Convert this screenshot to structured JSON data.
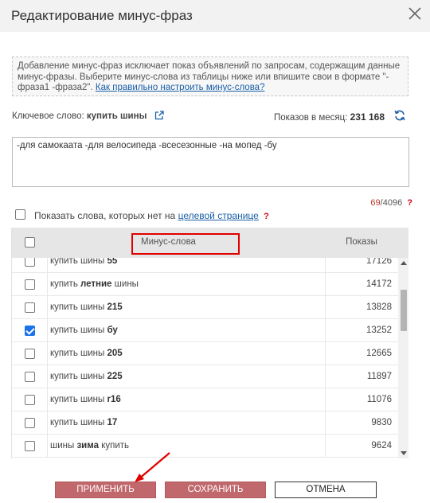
{
  "dialog": {
    "title": "Редактирование минус-фраз",
    "info_text": "Добавление минус-фраз исключает показ объявлений по запросам, содержащим данные минус-фразы. Выберите минус-слова из таблицы ниже или впишите свои в формате \"-фраза1 -фраза2\".",
    "info_link": "Как правильно настроить минус-слова?"
  },
  "keyword": {
    "label": "Ключевое слово:",
    "value": "купить шины",
    "shows_label": "Показов в месяц:",
    "shows_value": "231 168"
  },
  "minus_text": "-для самокаата -для велосипеда -всесезонные -на мопед -бу",
  "counter": {
    "current": "69",
    "max": "/4096",
    "help": "?"
  },
  "show_missing": {
    "text": "Показать слова, которых нет на",
    "link": "целевой странице",
    "help": "?"
  },
  "table": {
    "col_words": "Минус-слова",
    "col_shows": "Показы",
    "rows": [
      {
        "pre": "купить шины ",
        "bold": "55",
        "post": "",
        "count": "17126",
        "checked": false
      },
      {
        "pre": "купить ",
        "bold": "летние",
        "post": " шины",
        "count": "14172",
        "checked": false
      },
      {
        "pre": "купить шины ",
        "bold": "215",
        "post": "",
        "count": "13828",
        "checked": false
      },
      {
        "pre": "купить шины ",
        "bold": "бу",
        "post": "",
        "count": "13252",
        "checked": true
      },
      {
        "pre": "купить шины ",
        "bold": "205",
        "post": "",
        "count": "12665",
        "checked": false
      },
      {
        "pre": "купить шины ",
        "bold": "225",
        "post": "",
        "count": "11897",
        "checked": false
      },
      {
        "pre": "купить шины ",
        "bold": "r16",
        "post": "",
        "count": "11076",
        "checked": false
      },
      {
        "pre": "купить шины ",
        "bold": "17",
        "post": "",
        "count": "9830",
        "checked": false
      },
      {
        "pre": "шины ",
        "bold": "зима",
        "post": " купить",
        "count": "9624",
        "checked": false
      }
    ]
  },
  "buttons": {
    "apply": "ПРИМЕНИТЬ",
    "save": "СОХРАНИТЬ",
    "cancel": "ОТМЕНА"
  },
  "colors": {
    "accent_button": "#c1686d",
    "highlight": "#e00000",
    "link": "#1a5fa8"
  }
}
